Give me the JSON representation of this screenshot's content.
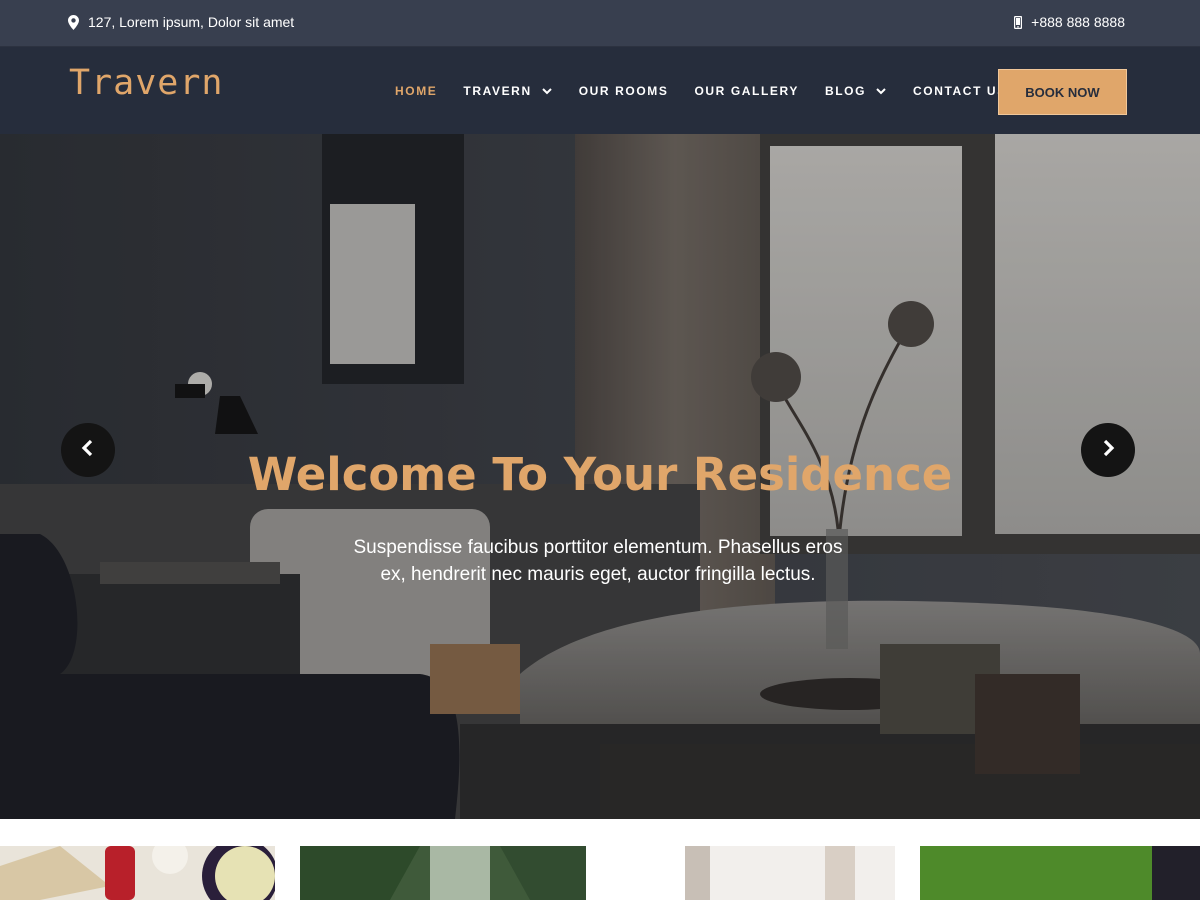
{
  "topbar": {
    "address": "127, Lorem ipsum, Dolor sit amet",
    "address_icon": "map-pin-icon",
    "phone": "+888 888 8888",
    "phone_icon": "phone-icon"
  },
  "header": {
    "logo": "Travern",
    "nav": [
      {
        "label": "HOME",
        "active": true,
        "dropdown": false
      },
      {
        "label": "TRAVERN",
        "active": false,
        "dropdown": true
      },
      {
        "label": "OUR ROOMS",
        "active": false,
        "dropdown": false
      },
      {
        "label": "OUR GALLERY",
        "active": false,
        "dropdown": false
      },
      {
        "label": "BLOG",
        "active": false,
        "dropdown": true
      },
      {
        "label": "CONTACT US",
        "active": false,
        "dropdown": false
      }
    ],
    "book_button": "BOOK NOW"
  },
  "hero": {
    "title": "Welcome To Your Residence",
    "subtitle": "Suspendisse faucibus porttitor elementum. Phasellus eros ex, hendrerit nec mauris eget, auctor fringilla lectus.",
    "prev_icon": "chevron-left-icon",
    "next_icon": "chevron-right-icon"
  },
  "colors": {
    "accent": "#e0a66a",
    "topbar_bg": "#383f4f",
    "header_bg": "#262d3c"
  }
}
